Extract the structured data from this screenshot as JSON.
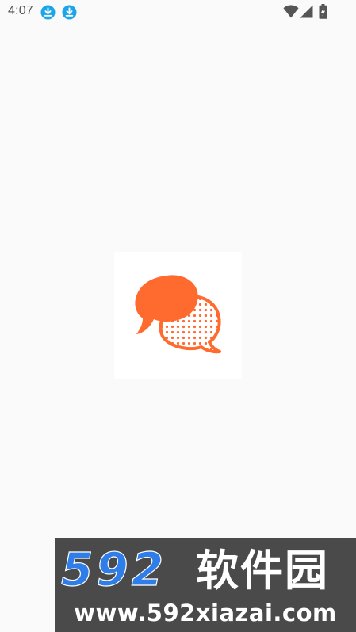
{
  "status_bar": {
    "time": "4:07",
    "download_color": "#1aa6e8",
    "icons": [
      "download-icon",
      "download-icon",
      "wifi-icon",
      "signal-icon",
      "battery-charging-icon"
    ]
  },
  "splash": {
    "logo_icon": "chat-bubbles-logo-icon",
    "accent_color": "#ff6a2f"
  },
  "watermark": {
    "number": "592",
    "chinese": "软件园",
    "url": "www.592xiazai.com",
    "number_color": "#2f7de8",
    "text_color": "#ffffff",
    "background": "#4a4a4a"
  }
}
